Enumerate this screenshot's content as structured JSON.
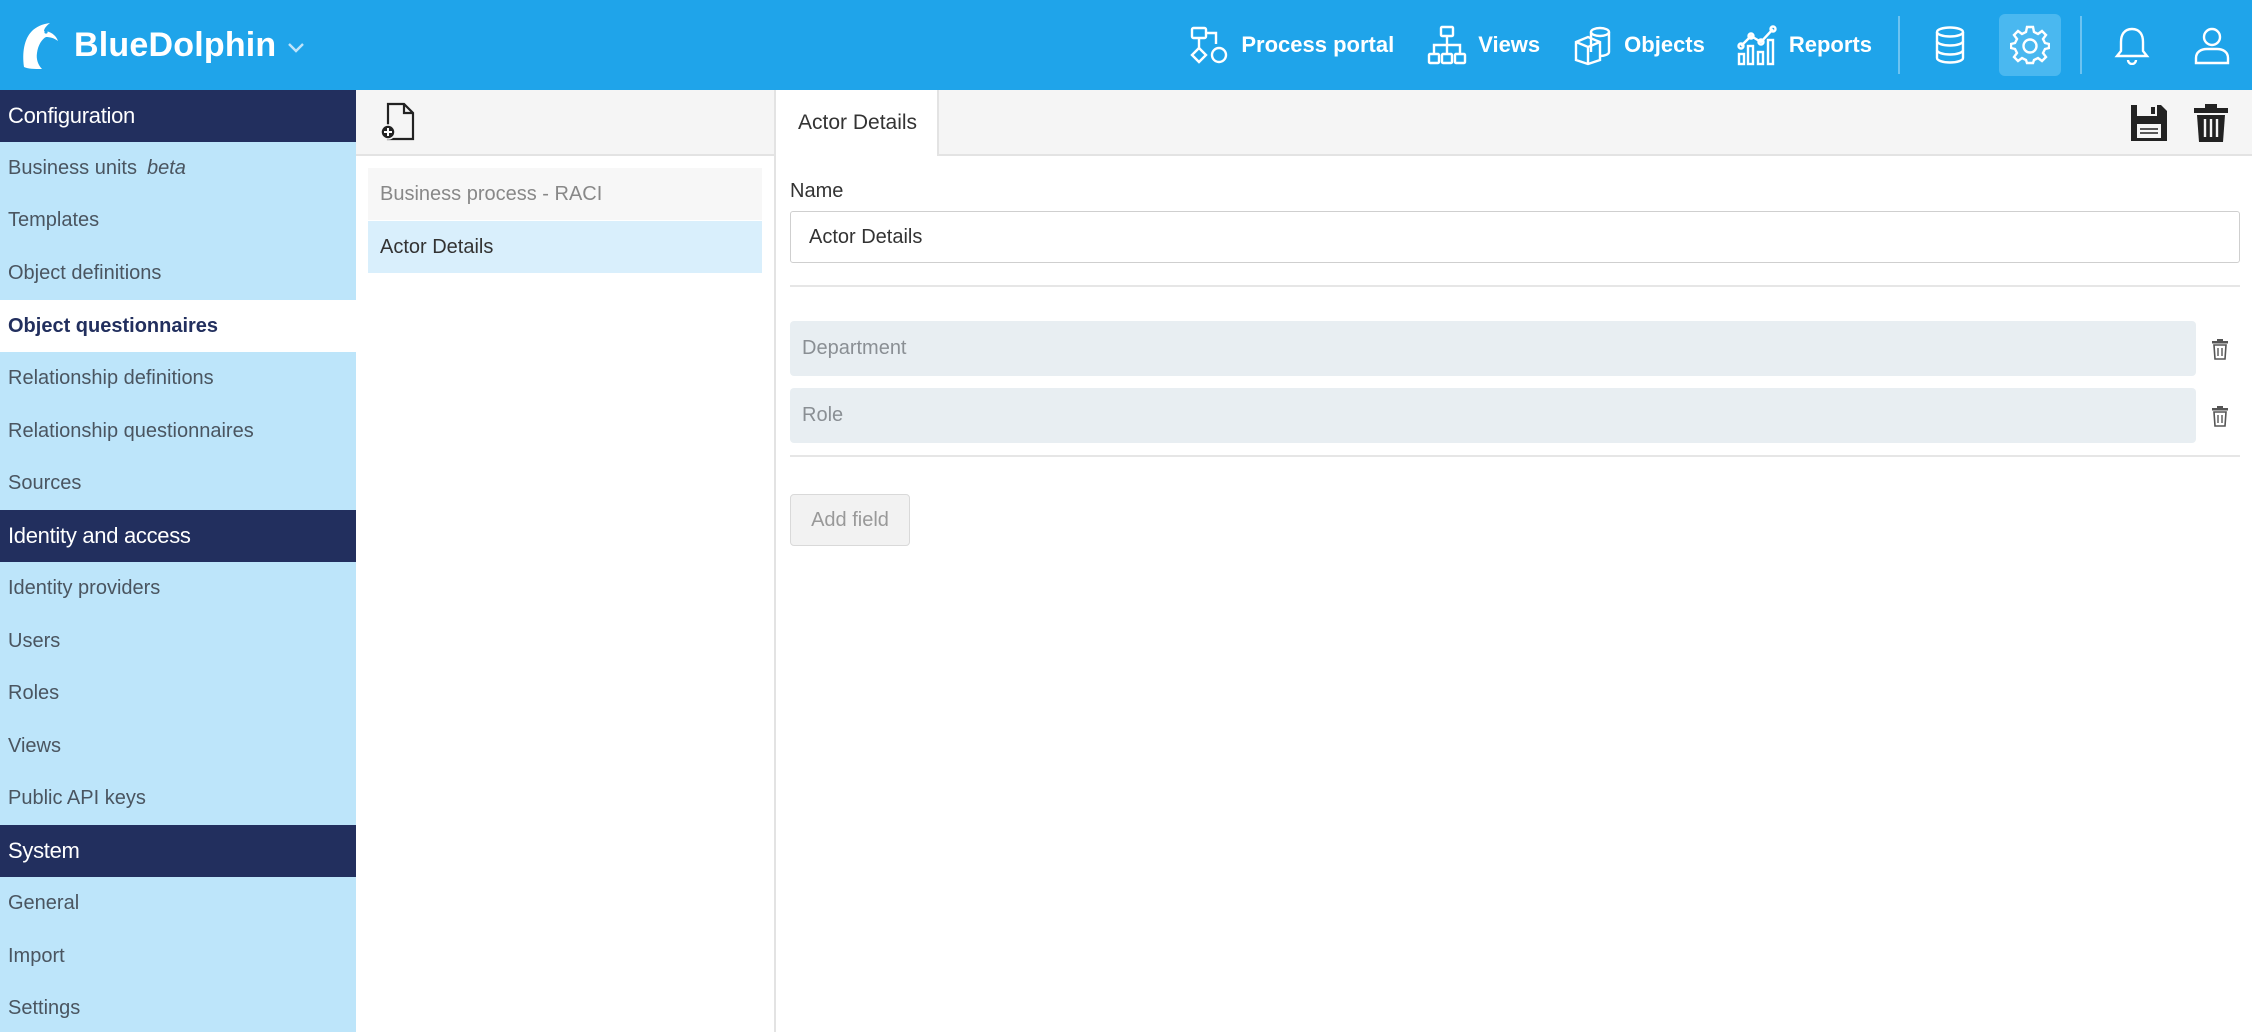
{
  "app": {
    "brand": "BlueDolphin",
    "nav": [
      {
        "label": "Process portal",
        "icon": "process-portal-icon"
      },
      {
        "label": "Views",
        "icon": "views-icon"
      },
      {
        "label": "Objects",
        "icon": "objects-icon"
      },
      {
        "label": "Reports",
        "icon": "reports-icon"
      }
    ],
    "icon_buttons": [
      "database-icon",
      "gear-icon",
      "bell-icon",
      "user-icon"
    ]
  },
  "sidebar": {
    "sections": [
      {
        "title": "Configuration",
        "items": [
          {
            "label": "Business units",
            "tag": "beta"
          },
          {
            "label": "Templates"
          },
          {
            "label": "Object definitions"
          },
          {
            "label": "Object questionnaires",
            "active": true
          },
          {
            "label": "Relationship definitions"
          },
          {
            "label": "Relationship questionnaires"
          },
          {
            "label": "Sources"
          }
        ]
      },
      {
        "title": "Identity and access",
        "items": [
          {
            "label": "Identity providers"
          },
          {
            "label": "Users"
          },
          {
            "label": "Roles"
          },
          {
            "label": "Views"
          },
          {
            "label": "Public API keys"
          }
        ]
      },
      {
        "title": "System",
        "items": [
          {
            "label": "General"
          },
          {
            "label": "Import"
          },
          {
            "label": "Settings"
          }
        ]
      }
    ]
  },
  "questionnaires": {
    "items": [
      {
        "label": "Business process - RACI"
      },
      {
        "label": "Actor Details",
        "active": true
      }
    ]
  },
  "detail": {
    "tab": "Actor Details",
    "name_label": "Name",
    "name_value": "Actor Details",
    "fields": [
      {
        "label": "Department"
      },
      {
        "label": "Role"
      }
    ],
    "add_field_label": "Add field"
  },
  "colors": {
    "topbar": "#1fa4ea",
    "sidebar": "#bde5fa",
    "section_header": "#222f5e",
    "active_item": "#d9effc"
  }
}
